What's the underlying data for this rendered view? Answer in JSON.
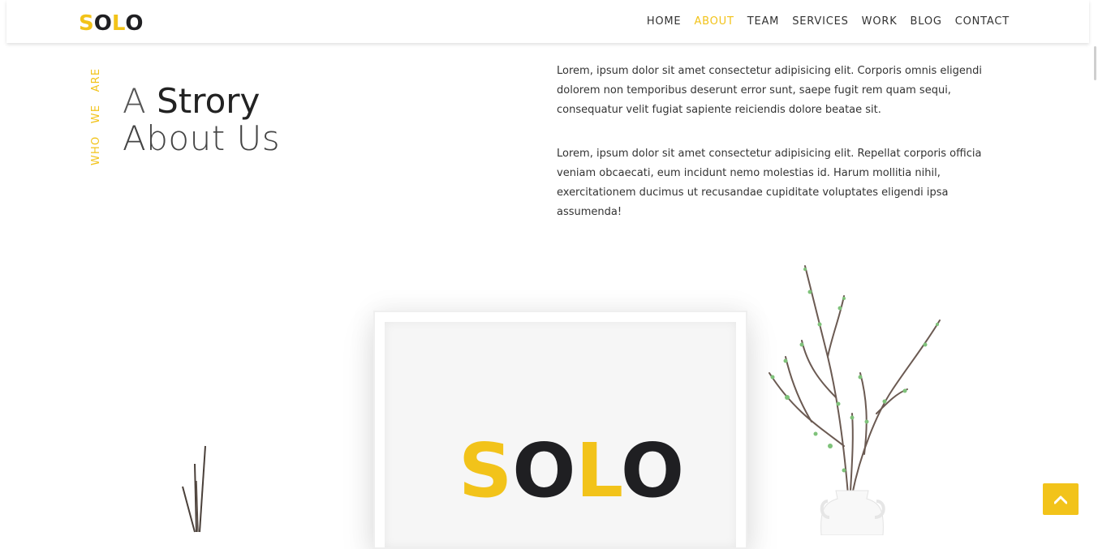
{
  "brand": {
    "letters": [
      "S",
      "O",
      "L",
      "O"
    ]
  },
  "nav": {
    "items": [
      {
        "label": "HOME"
      },
      {
        "label": "ABOUT",
        "active": true
      },
      {
        "label": "TEAM"
      },
      {
        "label": "SERVICES"
      },
      {
        "label": "WORK"
      },
      {
        "label": "BLOG"
      },
      {
        "label": "CONTACT"
      }
    ]
  },
  "about": {
    "vertical_label": "WHO WE ARE",
    "title_prefix": "A",
    "title_word": "Strory",
    "title_line2": "About Us",
    "paragraph1": "Lorem, ipsum dolor sit amet consectetur adipisicing elit. Corporis omnis eligendi dolorem non temporibus deserunt error sunt, saepe fugit rem quam sequi, consequatur velit fugiat sapiente reiciendis dolore beatae sit.",
    "paragraph2": "Lorem, ipsum dolor sit amet consectetur adipisicing elit. Repellat corporis officia veniam obcaecati, eum incidunt nemo molestias id. Harum mollitia nihil, exercitationem ducimus ut recusandae cupiditate voluptates eligendi ipsa assumenda!"
  },
  "frame_logo": {
    "letters": [
      "S",
      "O",
      "L",
      "O"
    ]
  },
  "icons": {
    "to_top": "chevron-up-icon"
  },
  "colors": {
    "accent": "#f2c31a",
    "dark": "#1f1f22"
  }
}
